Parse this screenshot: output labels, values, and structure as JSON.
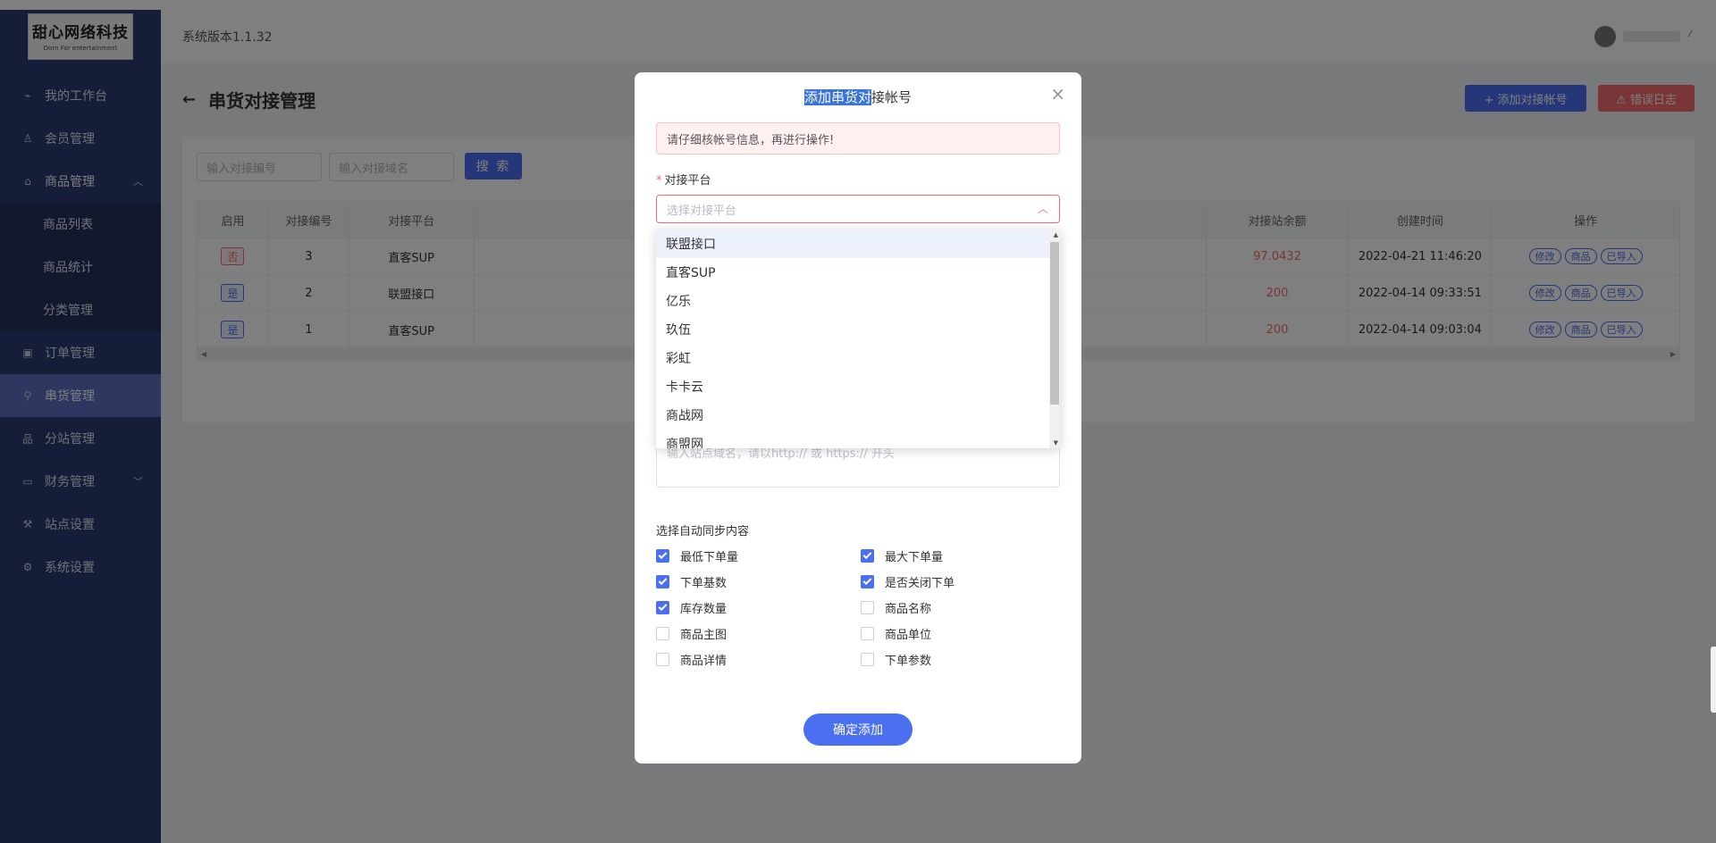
{
  "logo": {
    "main": "甜心网络科技",
    "sub": "Dorn For entertainment"
  },
  "sidebar": {
    "items": [
      {
        "label": "我的工作台",
        "icon": "chart-icon"
      },
      {
        "label": "会员管理",
        "icon": "users-icon"
      },
      {
        "label": "商品管理",
        "icon": "bag-icon",
        "arrow": "^"
      },
      {
        "label": "订单管理",
        "icon": "order-icon"
      },
      {
        "label": "串货管理",
        "icon": "link-icon"
      },
      {
        "label": "分站管理",
        "icon": "sitemap-icon"
      },
      {
        "label": "财务管理",
        "icon": "wallet-icon",
        "arrow": "v"
      },
      {
        "label": "站点设置",
        "icon": "wrench-icon"
      },
      {
        "label": "系统设置",
        "icon": "gear-icon"
      }
    ],
    "submenu": [
      "商品列表",
      "商品统计",
      "分类管理"
    ]
  },
  "header": {
    "version": "系统版本1.1.32"
  },
  "page": {
    "title": "串货对接管理",
    "add_button": "+ 添加对接帐号",
    "error_button": "⚠ 错误日志",
    "search_code_placeholder": "输入对接编号",
    "search_domain_placeholder": "输入对接域名",
    "search_button": "搜 索"
  },
  "table": {
    "headers": [
      "启用",
      "对接编号",
      "对接平台",
      "对接站余额",
      "创建时间",
      "操作"
    ],
    "rows": [
      {
        "enabled": "否",
        "id": "3",
        "platform": "直客SUP",
        "balance": "97.0432",
        "created": "2022-04-21 11:46:20"
      },
      {
        "enabled": "是",
        "id": "2",
        "platform": "联盟接口",
        "balance": "200",
        "created": "2022-04-14 09:33:51"
      },
      {
        "enabled": "是",
        "id": "1",
        "platform": "直客SUP",
        "balance": "200",
        "created": "2022-04-14 09:03:04"
      }
    ],
    "actions": [
      "修改",
      "商品",
      "已导入"
    ]
  },
  "modal": {
    "title_selected": "添加串货对",
    "title_rest": "接帐号",
    "close": "×",
    "alert": "请仔细核帐号信息，再进行操作!",
    "platform_label": "对接平台",
    "required_mark": "*",
    "platform_placeholder": "选择对接平台",
    "platform_options": [
      "联盟接口",
      "直客SUP",
      "亿乐",
      "玖伍",
      "彩虹",
      "卡卡云",
      "商战网",
      "商盟网"
    ],
    "domain_placeholder": "输入站点域名，请以http:// 或 https:// 开头",
    "sync_title": "选择自动同步内容",
    "sync_options": [
      {
        "label": "最低下单量",
        "checked": true
      },
      {
        "label": "最大下单量",
        "checked": true
      },
      {
        "label": "下单基数",
        "checked": true
      },
      {
        "label": "是否关闭下单",
        "checked": true
      },
      {
        "label": "库存数量",
        "checked": true
      },
      {
        "label": "商品名称",
        "checked": false
      },
      {
        "label": "商品主图",
        "checked": false
      },
      {
        "label": "商品单位",
        "checked": false
      },
      {
        "label": "商品详情",
        "checked": false
      },
      {
        "label": "下单参数",
        "checked": false
      }
    ],
    "confirm_button": "确定添加"
  }
}
